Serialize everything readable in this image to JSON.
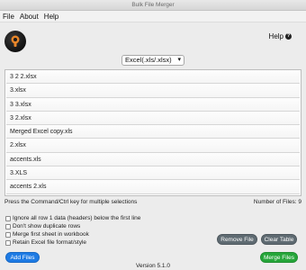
{
  "window": {
    "title": "Bulk File Merger"
  },
  "menu": {
    "items": [
      "File",
      "About",
      "Help"
    ]
  },
  "header": {
    "help_label": "Help",
    "help_icon": "question-circle-icon",
    "logo_icon": "funnel-logo-icon"
  },
  "format_select": {
    "value": "Excel(.xls/.xlsx)"
  },
  "files": [
    "3 2 2.xlsx",
    "3.xlsx",
    "3 3.xlsx",
    "3 2.xlsx",
    "Merged Excel copy.xls",
    "2.xlsx",
    "accents.xls",
    "3.XLS",
    "accents 2.xls"
  ],
  "list_hint": "Press the Command/Ctrl key for multiple selections",
  "file_count": "Number of Files: 9",
  "options": [
    {
      "label": "Ignore all row 1 data (headers) below the first line",
      "checked": false
    },
    {
      "label": "Don't show duplicate rows",
      "checked": false
    },
    {
      "label": "Merge first sheet in workbook",
      "checked": false
    },
    {
      "label": "Retain Excel file format/style",
      "checked": false
    }
  ],
  "buttons": {
    "remove_file": "Remove File",
    "clear_table": "Clear Table",
    "add_files": "Add Files",
    "merge_files": "Merge Files"
  },
  "version": "Version 5.1.0",
  "colors": {
    "add_files": "#1e7be4",
    "merge_files": "#26a63a",
    "gray_button": "#5f6b72"
  }
}
